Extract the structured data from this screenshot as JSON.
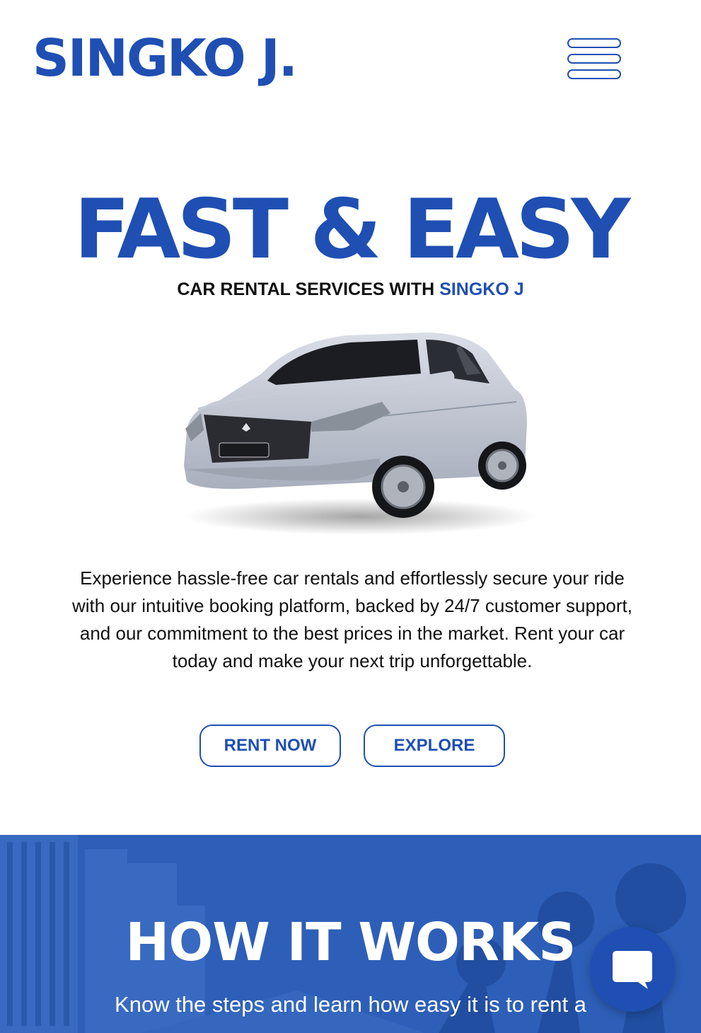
{
  "header": {
    "logo": "SINGKO J.",
    "menu_icon": "hamburger-menu-icon"
  },
  "hero": {
    "title": "FAST & EASY",
    "subtitle_prefix": "CAR RENTAL SERVICES WITH ",
    "subtitle_brand": "SINGKO J",
    "description": "Experience hassle-free car rentals and effortlessly secure your ride with our intuitive booking platform, backed by 24/7 customer support, and our commitment to the best prices in the market. Rent your car today and make your next trip unforgettable.",
    "rent_button": "RENT NOW",
    "explore_button": "EXPLORE"
  },
  "how_it_works": {
    "title": "HOW IT WORKS",
    "text": "Know the steps and learn how easy it is to rent a"
  },
  "chat": {
    "icon": "chat-bubble-icon"
  },
  "colors": {
    "brand_blue": "#1f4fb3",
    "section_blue": "#2d5fb8",
    "text": "#111111",
    "background": "#ffffff"
  }
}
